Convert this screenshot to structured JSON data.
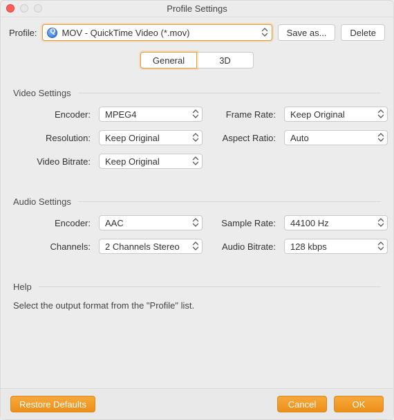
{
  "window": {
    "title": "Profile Settings"
  },
  "toprow": {
    "label": "Profile:",
    "selected": "MOV - QuickTime Video (*.mov)",
    "save_as": "Save as...",
    "delete": "Delete"
  },
  "tabs": {
    "general": "General",
    "threeD": "3D"
  },
  "video": {
    "heading": "Video Settings",
    "encoder_label": "Encoder:",
    "encoder_value": "MPEG4",
    "framerate_label": "Frame Rate:",
    "framerate_value": "Keep Original",
    "resolution_label": "Resolution:",
    "resolution_value": "Keep Original",
    "aspect_label": "Aspect Ratio:",
    "aspect_value": "Auto",
    "vbitrate_label": "Video Bitrate:",
    "vbitrate_value": "Keep Original"
  },
  "audio": {
    "heading": "Audio Settings",
    "encoder_label": "Encoder:",
    "encoder_value": "AAC",
    "samplerate_label": "Sample Rate:",
    "samplerate_value": "44100 Hz",
    "channels_label": "Channels:",
    "channels_value": "2 Channels Stereo",
    "abitrate_label": "Audio Bitrate:",
    "abitrate_value": "128 kbps"
  },
  "help": {
    "heading": "Help",
    "text": "Select the output format from the \"Profile\" list."
  },
  "footer": {
    "restore": "Restore Defaults",
    "cancel": "Cancel",
    "ok": "OK"
  }
}
